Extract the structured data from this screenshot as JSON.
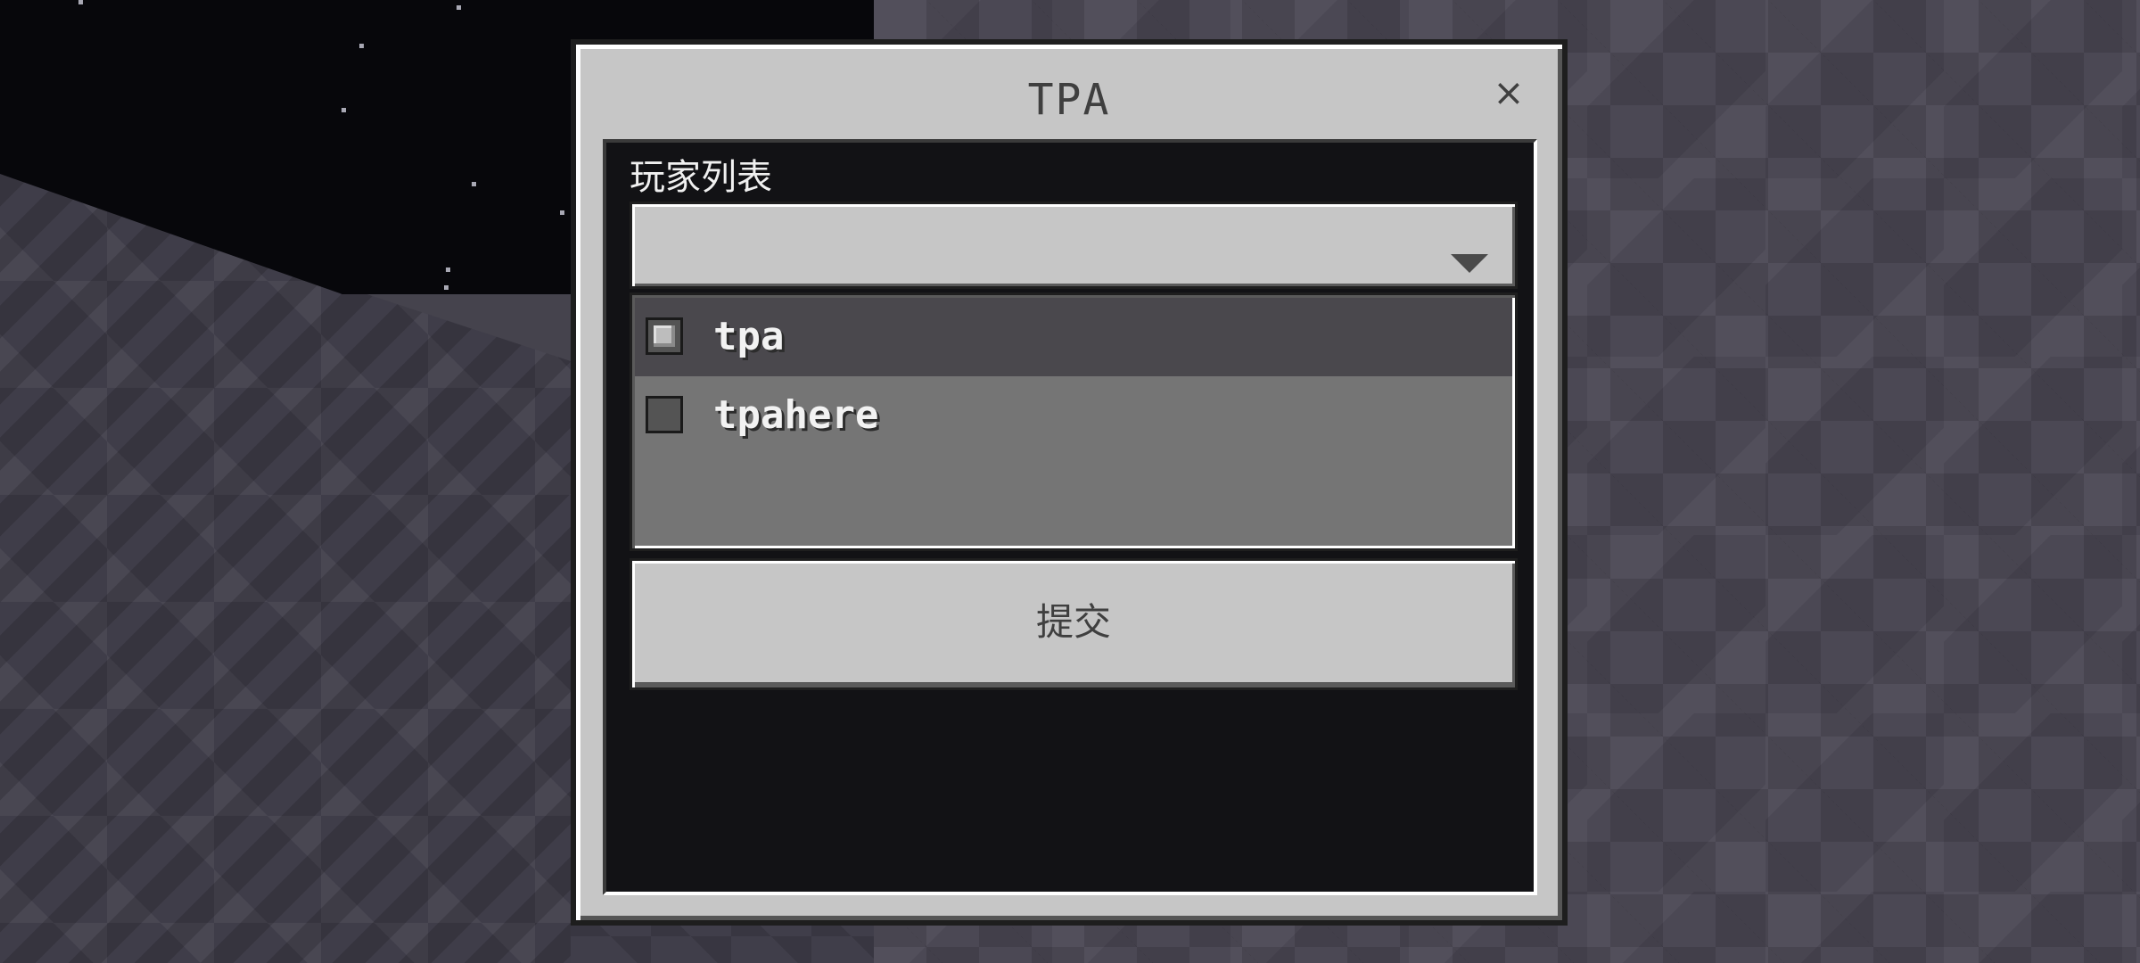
{
  "dialog": {
    "title": "TPA",
    "close_label": "×"
  },
  "form": {
    "section_label": "玩家列表",
    "dropdown": {
      "selected_value": ""
    },
    "options": [
      {
        "label": "tpa",
        "checked": true
      },
      {
        "label": "tpahere",
        "checked": false
      }
    ],
    "submit_label": "提交"
  },
  "colors": {
    "dialog_bg": "#c6c6c6",
    "content_bg": "#121215",
    "option_selected_bg": "#4a484d",
    "options_bg": "#757575"
  }
}
